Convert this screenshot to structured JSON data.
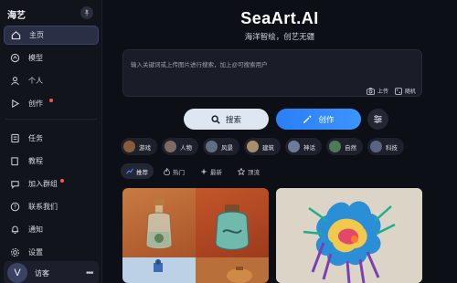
{
  "sidebar": {
    "brand": "海艺",
    "nav": [
      {
        "label": "主页",
        "icon": "home-icon",
        "active": true
      },
      {
        "label": "模型",
        "icon": "model-icon"
      },
      {
        "label": "个人",
        "icon": "user-icon"
      },
      {
        "label": "创作",
        "icon": "play-icon",
        "badge": true
      }
    ],
    "nav2": [
      {
        "label": "任务",
        "icon": "task-icon"
      },
      {
        "label": "教程",
        "icon": "book-icon"
      },
      {
        "label": "加入群组",
        "icon": "group-icon",
        "badge": true
      },
      {
        "label": "联系我们",
        "icon": "help-icon"
      },
      {
        "label": "通知",
        "icon": "bell-icon"
      },
      {
        "label": "设置",
        "icon": "gear-icon"
      }
    ],
    "user": {
      "avatar_letter": "V",
      "name": "访客",
      "more": "•••"
    }
  },
  "main": {
    "title": "SeaArt.AI",
    "subtitle": "海洋智绘，创艺无疆",
    "prompt_placeholder": "输入关键词或上传图片进行搜索，加上@可搜索用户",
    "upload_label": "上传",
    "random_label": "随机",
    "search_button": "搜索",
    "create_button": "创作"
  },
  "categories": [
    {
      "label": "游戏",
      "color": "#8a5a3c"
    },
    {
      "label": "人物",
      "color": "#7d6a63"
    },
    {
      "label": "风景",
      "color": "#5f6f7f"
    },
    {
      "label": "建筑",
      "color": "#a68f6a"
    },
    {
      "label": "神话",
      "color": "#6b7c9a"
    },
    {
      "label": "自然",
      "color": "#4f7a5a"
    },
    {
      "label": "科技",
      "color": "#566584"
    }
  ],
  "tabs": [
    {
      "label": "推荐",
      "icon": "trend-icon",
      "active": true
    },
    {
      "label": "热门",
      "icon": "fire-icon"
    },
    {
      "label": "最新",
      "icon": "sparkle-icon"
    },
    {
      "label": "顶流",
      "icon": "star-icon"
    }
  ],
  "colors": {
    "accent": "#2f86ff",
    "background": "#0d0f16",
    "sidebar": "#12141c"
  }
}
